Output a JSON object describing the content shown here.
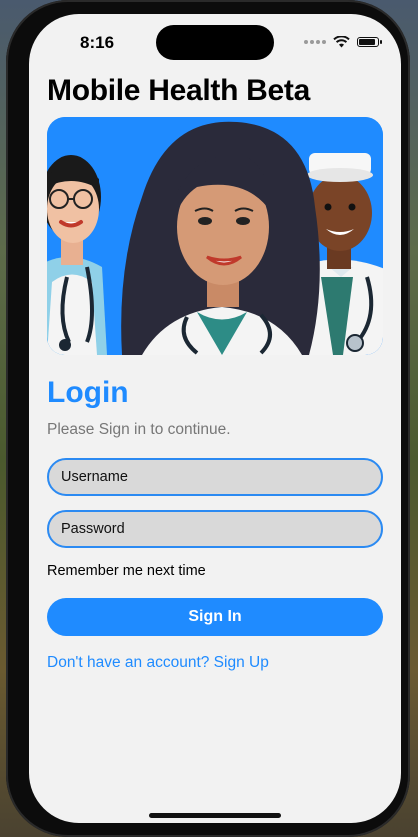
{
  "status_bar": {
    "time": "8:16",
    "icons": [
      "signal-dots-icon",
      "wifi-icon",
      "battery-icon"
    ]
  },
  "app": {
    "title": "Mobile Health Beta"
  },
  "hero": {
    "image": "illustration of three healthcare workers with stethoscopes",
    "background_color": "#1f8bff"
  },
  "login": {
    "title": "Login",
    "subtitle": "Please Sign in to continue.",
    "username_placeholder": "Username",
    "password_placeholder": "Password",
    "remember_label": "Remember me next time",
    "sign_in_label": "Sign In",
    "signup_link": "Don't have an account? Sign Up"
  },
  "colors": {
    "accent": "#1f8bff",
    "field_bg": "#d9d9d9",
    "screen_bg": "#f2f2f2"
  }
}
